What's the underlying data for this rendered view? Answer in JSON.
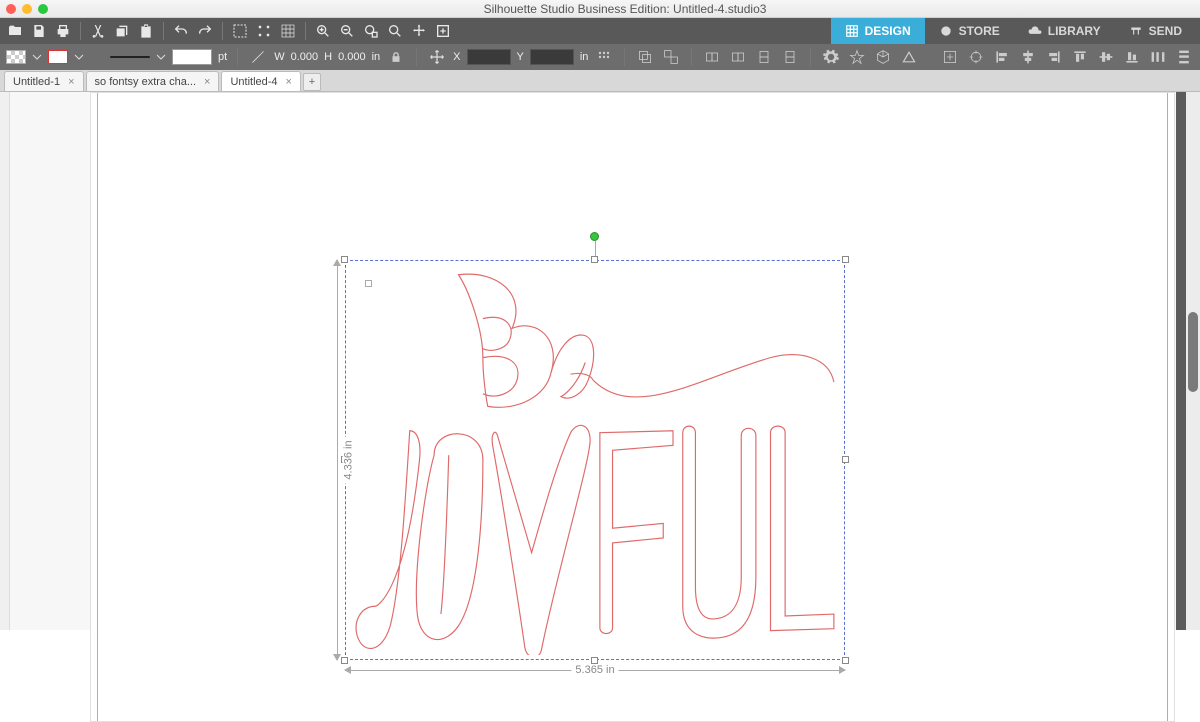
{
  "app": {
    "title": "Silhouette Studio Business Edition: Untitled-4.studio3"
  },
  "nav": {
    "design": "DESIGN",
    "store": "STORE",
    "library": "LIBRARY",
    "send": "SEND"
  },
  "toolbar2": {
    "pt_unit": "pt",
    "w_label": "W",
    "w_value": "0.000",
    "h_label": "H",
    "h_value": "0.000",
    "wh_unit": "in",
    "x_label": "X",
    "y_label": "Y",
    "xy_unit": "in"
  },
  "doctabs": [
    {
      "label": "Untitled-1"
    },
    {
      "label": "so fontsy extra cha..."
    },
    {
      "label": "Untitled-4"
    }
  ],
  "selection": {
    "height_label": "4.336 in",
    "width_label": "5.365 in"
  }
}
